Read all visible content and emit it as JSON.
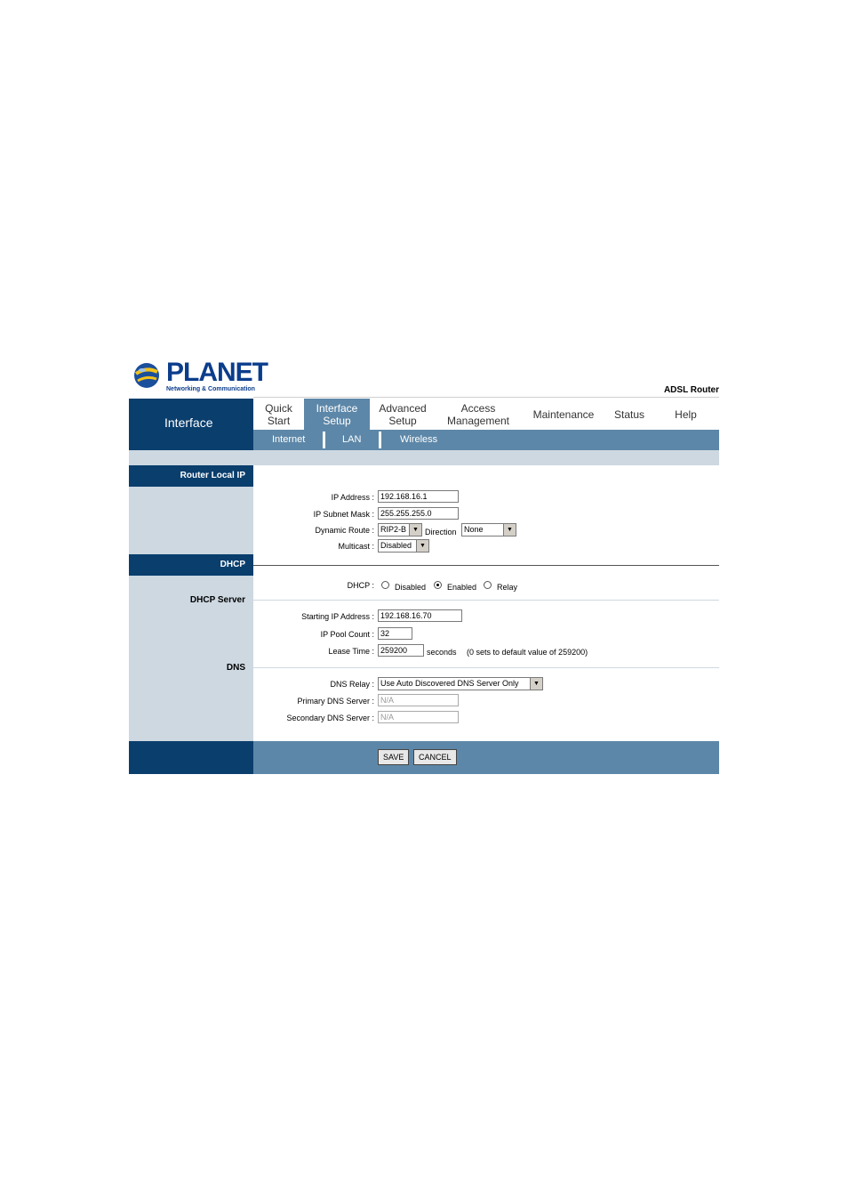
{
  "brand": {
    "name": "PLANET",
    "tagline": "Networking & Communication",
    "product": "ADSL Router"
  },
  "nav": {
    "section_title": "Interface",
    "tabs": [
      {
        "label": "Quick Start"
      },
      {
        "label": "Interface Setup"
      },
      {
        "label": "Advanced Setup"
      },
      {
        "label": "Access Management"
      },
      {
        "label": "Maintenance"
      },
      {
        "label": "Status"
      },
      {
        "label": "Help"
      }
    ],
    "active_tab": "Interface Setup",
    "subtabs": [
      {
        "label": "Internet"
      },
      {
        "label": "LAN"
      },
      {
        "label": "Wireless"
      }
    ],
    "active_subtab": "LAN"
  },
  "router_local_ip": {
    "title": "Router Local IP",
    "ip_label": "IP Address :",
    "ip_value": "192.168.16.1",
    "mask_label": "IP Subnet Mask :",
    "mask_value": "255.255.255.0",
    "route_label": "Dynamic Route :",
    "route_value": "RIP2-B",
    "direction_label": "Direction",
    "direction_value": "None",
    "multicast_label": "Multicast :",
    "multicast_value": "Disabled"
  },
  "dhcp": {
    "title": "DHCP",
    "label": "DHCP :",
    "options": [
      "Disabled",
      "Enabled",
      "Relay"
    ],
    "selected": "Enabled",
    "server_title": "DHCP Server",
    "start_label": "Starting IP Address :",
    "start_value": "192.168.16.70",
    "pool_label": "IP Pool Count :",
    "pool_value": "32",
    "lease_label": "Lease Time :",
    "lease_value": "259200",
    "lease_unit": "seconds",
    "lease_note": "(0 sets to default value of 259200)"
  },
  "dns": {
    "title": "DNS",
    "relay_label": "DNS Relay :",
    "relay_value": "Use Auto Discovered DNS Server Only",
    "primary_label": "Primary DNS Server :",
    "primary_value": "N/A",
    "secondary_label": "Secondary DNS Server :",
    "secondary_value": "N/A"
  },
  "buttons": {
    "save": "SAVE",
    "cancel": "CANCEL"
  },
  "colors": {
    "dark_blue": "#0a3e6d",
    "mid_blue": "#5d87a8",
    "light_gray_blue": "#cdd8e1"
  }
}
